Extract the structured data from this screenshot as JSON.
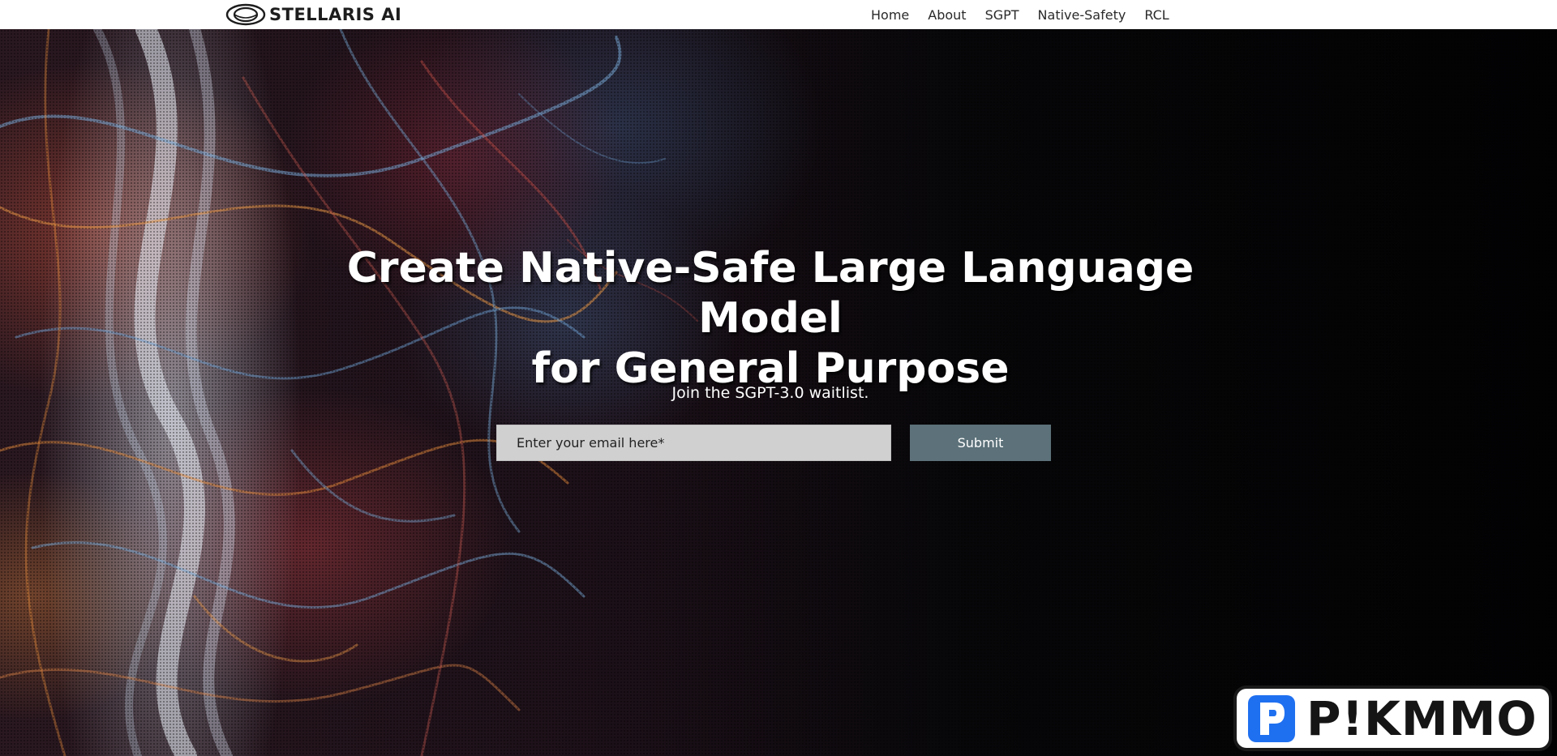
{
  "header": {
    "brand": "STELLARIS AI",
    "nav": [
      {
        "label": "Home"
      },
      {
        "label": "About"
      },
      {
        "label": "SGPT"
      },
      {
        "label": "Native-Safety"
      },
      {
        "label": "RCL"
      }
    ]
  },
  "hero": {
    "title_line1": "Create Native-Safe Large Language Model",
    "title_line2": "for General Purpose",
    "subtitle": "Join the SGPT-3.0 waitlist.",
    "email_placeholder": "Enter your email here*",
    "submit_label": "Submit"
  },
  "watermark": {
    "text": "P!KMMO",
    "color": "#1f70f0"
  }
}
